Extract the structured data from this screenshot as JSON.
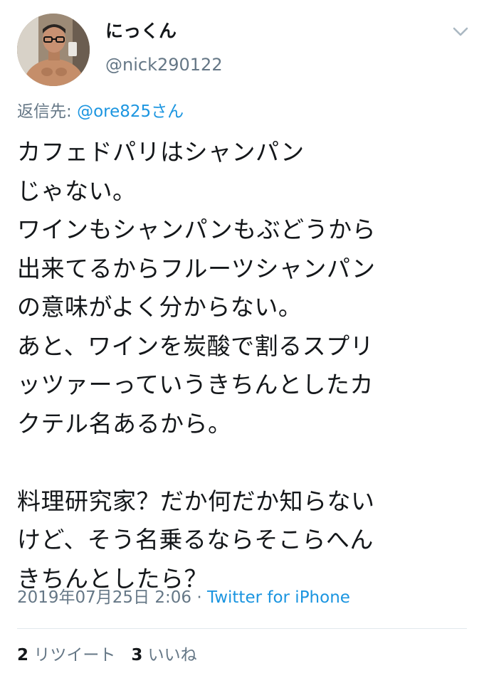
{
  "tweet": {
    "author": {
      "display_name": "にっくん",
      "handle": "@nick290122"
    },
    "menu_icon": "chevron-down-icon",
    "reply_prefix": "返信先: ",
    "reply_to": "@ore825さん",
    "text_lines": [
      "カフェドパリはシャンパン",
      "じゃない。",
      "ワインもシャンパンもぶどうから",
      "出来てるからフルーツシャンパン",
      "の意味がよく分からない。",
      "あと、ワインを炭酸で割るスプリ",
      "ッツァーっていうきちんとしたカ",
      "クテル名あるから。",
      "",
      "料理研究家？だか何だか知らない",
      "けど、そう名乗るならそこらへん",
      "きちんとしたら？"
    ],
    "timestamp": "2019年07月25日 2:06",
    "separator": " · ",
    "source": "Twitter for iPhone",
    "retweet_count": "2",
    "retweet_label": "リツイート",
    "like_count": "3",
    "like_label": "いいね"
  },
  "colors": {
    "text": "#14171a",
    "secondary": "#657786",
    "link": "#1b95e0",
    "divider": "#e1e8ed"
  }
}
